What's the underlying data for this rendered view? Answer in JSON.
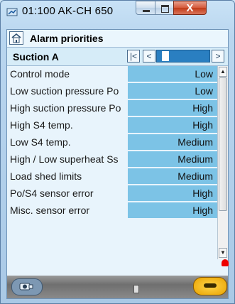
{
  "window": {
    "title": "01:100 AK-CH 650",
    "close_glyph": "X"
  },
  "header": {
    "title": "Alarm priorities",
    "icon": "home-icon"
  },
  "section": {
    "title": "Suction A",
    "nav_first_glyph": "|<",
    "nav_prev_glyph": "<",
    "nav_next_glyph": ">"
  },
  "rows": [
    {
      "label": "Control mode",
      "value": "Low"
    },
    {
      "label": "Low suction pressure Po",
      "value": "Low"
    },
    {
      "label": "High suction pressure Po",
      "value": "High"
    },
    {
      "label": "High S4 temp.",
      "value": "High"
    },
    {
      "label": "Low S4 temp.",
      "value": "Medium"
    },
    {
      "label": "High / Low superheat Ss",
      "value": "Medium"
    },
    {
      "label": "Load shed limits",
      "value": "Medium"
    },
    {
      "label": "Po/S4 sensor error",
      "value": "High"
    },
    {
      "label": "Misc. sensor error",
      "value": "High"
    }
  ],
  "colors": {
    "value_cell": "#7cc3e6",
    "panel_bg": "#e8f4fc",
    "nav_track": "#2a7fc1"
  },
  "footer": {
    "left_icon": "camera-icon",
    "right_icon": "key-icon",
    "alarm_icon": "bell-icon"
  }
}
